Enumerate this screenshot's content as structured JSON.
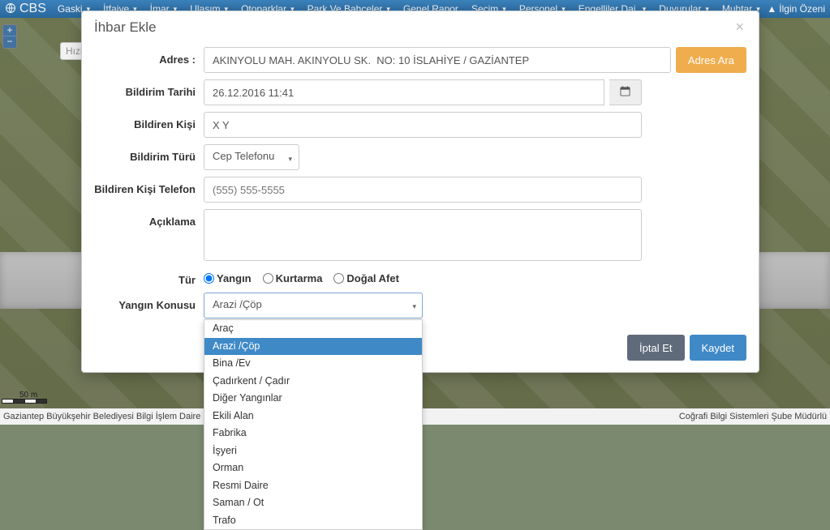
{
  "topbar": {
    "brand": "CBS",
    "nav": [
      "Gaski",
      "İtfaiye",
      "İmar",
      "Ulaşım",
      "Otoparklar",
      "Park Ve Bahçeler",
      "Genel Rapor",
      "Seçim",
      "Personel",
      "Engelliler Dai.",
      "Duyurular",
      "Muhtar"
    ],
    "user": "İlgin Özeni"
  },
  "quick_placeholder": "Hızlı P",
  "scale": "50 m",
  "modal": {
    "title": "İhbar Ekle",
    "labels": {
      "adres": "Adres :",
      "tarih": "Bildirim Tarihi",
      "kisi": "Bildiren Kişi",
      "turu": "Bildirim Türü",
      "telefon": "Bildiren Kişi Telefon",
      "aciklama": "Açıklama",
      "tur": "Tür",
      "konu": "Yangın Konusu"
    },
    "buttons": {
      "adres_ara": "Adres Ara",
      "iptal": "İptal Et",
      "kaydet": "Kaydet"
    },
    "values": {
      "adres": "AKINYOLU MAH. AKINYOLU SK.  NO: 10 İSLAHİYE / GAZİANTEP",
      "tarih": "26.12.2016 11:41",
      "kisi": "X Y",
      "turu": "Cep Telefonu",
      "konu": "Arazi /Çöp"
    },
    "placeholders": {
      "telefon": "(555) 555-5555"
    },
    "radios": {
      "yangin": "Yangın",
      "kurtarma": "Kurtarma",
      "afet": "Doğal Afet"
    },
    "konu_options": [
      "Araç",
      "Arazi /Çöp",
      "Bina /Ev",
      "Çadırkent / Çadır",
      "Diğer Yangınlar",
      "Ekili Alan",
      "Fabrika",
      "İşyeri",
      "Orman",
      "Resmi Daire",
      "Saman / Ot",
      "Trafo"
    ],
    "konu_selected_index": 1
  },
  "footer": {
    "left": "Gaziantep Büyükşehir Belediyesi Bilgi İşlem Daire Başkanlığı",
    "right": "Coğrafi Bilgi Sistemleri Şube Müdürlü"
  }
}
